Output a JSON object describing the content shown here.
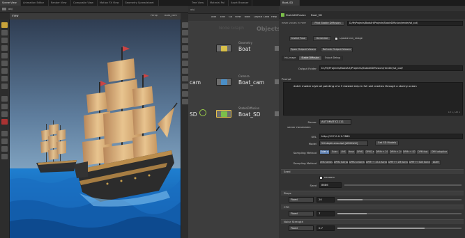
{
  "top_tabs": [
    "Scene View",
    "Animation Editor",
    "Render View",
    "Composite View",
    "Motion FX View",
    "Geometry Spreadsheet",
    "Tree View",
    "Material Pal",
    "Asset Browser",
    "Boat_SD"
  ],
  "viewer": {
    "path": "obj",
    "view_label": "View",
    "persp_label": "Persp",
    "cam_label": "Boat_cam"
  },
  "network": {
    "path": "obj",
    "menu": [
      "Add",
      "Edit",
      "Go",
      "View",
      "Tools",
      "Layout",
      "Labs",
      "Help"
    ],
    "watermark_label": "Objects",
    "watermark_sub": "Node Graph",
    "nodes": [
      {
        "type": "Geometry",
        "name": "Boat"
      },
      {
        "type": "Camera",
        "name": "Boat_cam"
      },
      {
        "type": "StableDiffusion",
        "name": "Boat_SD"
      }
    ],
    "cut_label_1": "cam",
    "cut_label_2": "SD"
  },
  "params": {
    "node_type": "StableDiffusion",
    "node_name": "Boat_SD",
    "row2_left": "Reset Values in Parm",
    "row2_mid": "Pilot Stable Diffusion",
    "row2_path": "D:/MyProjects/BoatArt/Projects/StableDiffusion/render/sd_out/",
    "buttons_row1": [
      "Install Fuse",
      "Generate"
    ],
    "update_label": "Update Init_Image",
    "buttons_row2": [
      "Open Output Viewer",
      "Refresh Output Viewer"
    ],
    "tabs": [
      "Init_Image",
      "Stable Diffusion",
      "Output Debug"
    ],
    "output_folder_label": "Output Folder",
    "output_folder_value": "D:/MyProjects/BoatArt/Projects/StableDiffusion/render/sd_out/",
    "prompt_label": "Prompt",
    "prompt_value": "dutch master style oil painting of a 3 masted ship in full sail crashes through a stormy ocean",
    "line_col": "Ln 1, Col 1",
    "server_label": "Server",
    "server_value": "AUTOMATIC1111",
    "server_params_label": "Server Parameters",
    "url_label": "URL",
    "url_value": "http://127.0.0.1:7860",
    "model_label": "Model",
    "model_value": "512-depth-ema.ckpt [d0522d12]",
    "get_models_label": "Get SD Models",
    "sampling_label_1": "Sampling Method",
    "sampling_row1": [
      "Euler a",
      "Euler",
      "LMS",
      "Heun",
      "DPM2",
      "DPM2 a",
      "DPM++ 2S a",
      "DPM++ 2M",
      "DPM++ SDE",
      "DPM fast",
      "DPM adaptive"
    ],
    "sampling_label_2": "Sampling Method",
    "sampling_row2": [
      "LMS Karras",
      "DPM2 Karras",
      "DPM2 a Karras",
      "DPM++ 2S a Karras",
      "DPM++ 2M Karras",
      "DPM++ SDE Karras",
      "DDIM"
    ],
    "seed_section": "Seed",
    "random_label": "Random",
    "seed_label": "Seed",
    "seed_value": "8686",
    "steps_section": "Steps",
    "steps_mode": "Fixed",
    "steps_value": "20",
    "cfg_section": "CFG",
    "cfg_mode": "Fixed",
    "cfg_value": "7",
    "noise_section": "Noise Strength",
    "noise_mode": "Fixed",
    "noise_value": "0.7"
  }
}
